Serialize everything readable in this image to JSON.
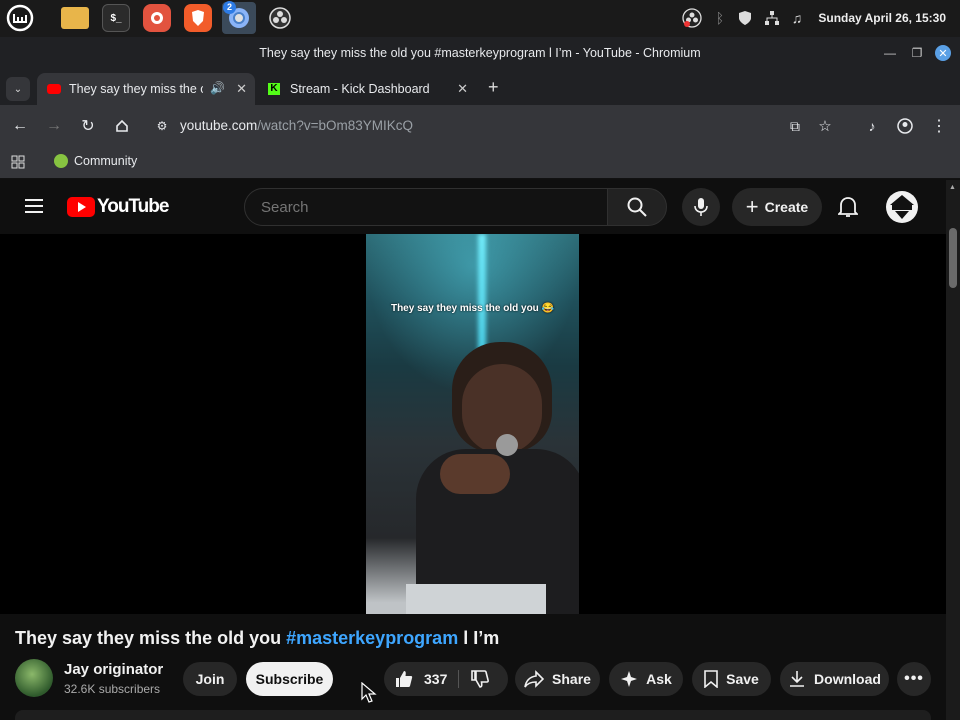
{
  "taskbar": {
    "apps": [
      {
        "icon": "linux-mint-menu-icon"
      },
      {
        "icon": "folder-icon"
      },
      {
        "icon": "terminal-icon",
        "glyph": "$_"
      },
      {
        "icon": "firefox-like-browser-icon"
      },
      {
        "icon": "brave-browser-icon"
      },
      {
        "icon": "chromium-icon",
        "badge": "2"
      },
      {
        "icon": "obs-icon"
      }
    ],
    "clock": "Sunday April 26, 15:30"
  },
  "window": {
    "title": "They say they miss the old you #masterkeyprogram l I’m - YouTube - Chromium"
  },
  "tabs": [
    {
      "label": "They say they miss the old you",
      "active": true,
      "favicon": "youtube-favicon",
      "audio": true
    },
    {
      "label": "Stream - Kick Dashboard",
      "active": false,
      "favicon": "kick-favicon"
    }
  ],
  "toolbar": {
    "url_host": "youtube.com",
    "url_path": "/watch?v=bOm83YMIKcQ"
  },
  "bookmarks": {
    "items": [
      {
        "label": "Community"
      }
    ]
  },
  "youtube": {
    "logo_text": "YouTube",
    "search_placeholder": "Search",
    "create_label": "Create",
    "video_overlay_text": "They say they miss the old you 😂",
    "video_title_prefix": "They say they miss the old you",
    "video_title_hashtag": "#masterkeyprogram",
    "video_title_suffix": "l I’m",
    "channel_name": "Jay originator",
    "subscribers": "32.6K subscribers",
    "join_label": "Join",
    "subscribe_label": "Subscribe",
    "like_count": "337",
    "share_label": "Share",
    "ask_label": "Ask",
    "save_label": "Save",
    "download_label": "Download"
  },
  "colors": {
    "youtube_red": "#ff0000",
    "link_blue": "#3ea6ff",
    "kick_green": "#53fc18"
  }
}
